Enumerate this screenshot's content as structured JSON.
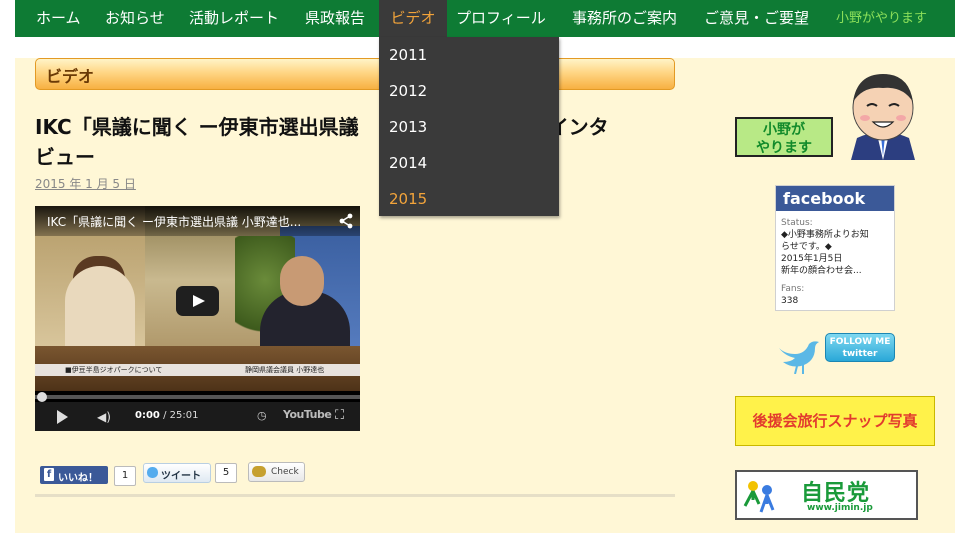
{
  "nav": {
    "items": [
      {
        "label": "ホーム"
      },
      {
        "label": "お知らせ"
      },
      {
        "label": "活動レポート"
      },
      {
        "label": "県政報告"
      },
      {
        "label": "ビデオ"
      },
      {
        "label": "プロフィール"
      },
      {
        "label": "事務所のご案内"
      },
      {
        "label": "ご意見・ご要望"
      }
    ],
    "slogan": "小野がやります",
    "active_index": 4,
    "active_color": "#f3a43a",
    "bar_color": "#0e7b34"
  },
  "dropdown": {
    "items": [
      "2011",
      "2012",
      "2013",
      "2014",
      "2015"
    ],
    "current": "2015"
  },
  "section": {
    "label": "ビデオ"
  },
  "post": {
    "title": "IKC「県議に聞く ー伊東市選出県議",
    "title_tail": "インタ",
    "title_line2": "ビュー",
    "date": "2015 年 1 月 5 日"
  },
  "video": {
    "title": "IKC「県議に聞く ー伊東市選出県議 小野達也...",
    "current_time": "0:00",
    "duration": "/ 25:01",
    "caption_left": "■伊豆半島ジオパークについて",
    "caption_right": "静岡県議会議員 小野達也",
    "youtube_label": "YouTube",
    "progress": 0
  },
  "social": {
    "like_label": "いいね！",
    "like_count": "1",
    "tweet_label": "ツイート",
    "tweet_count": "5",
    "check_label": "Check"
  },
  "sidebar": {
    "ono_badge_line1": "小野が",
    "ono_badge_line2": "やります",
    "facebook": {
      "header": "facebook",
      "status_label": "Status:",
      "status_lines": [
        "◆小野事務所よりお知",
        "らせです。◆",
        "2015年1月5日",
        "新年の顔合わせ会..."
      ],
      "fans_label": "Fans:",
      "fans_count": "338"
    },
    "twitter_badge_line1": "FOLLOW ME",
    "twitter_badge_line2": "twitter",
    "trip_button": "後援会旅行スナップ写真",
    "jimin_text": "自民党",
    "jimin_url": "www.jimin.jp"
  }
}
